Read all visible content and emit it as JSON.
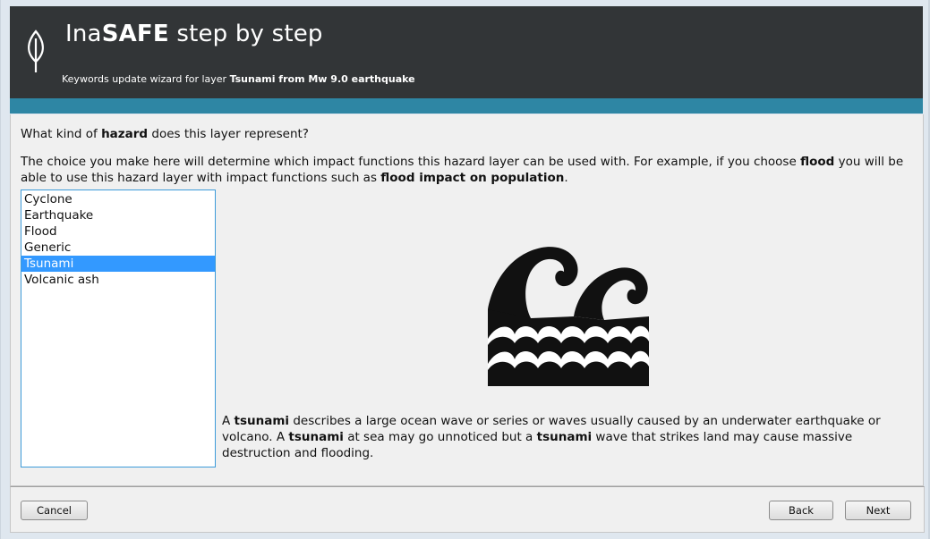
{
  "header": {
    "title_plain": "Ina",
    "title_bold": "SAFE",
    "title_rest": " step by step",
    "subtitle_prefix": "Keywords update wizard for layer ",
    "layer_name": "Tsunami from Mw 9.0 earthquake"
  },
  "question": {
    "pre": "What kind of ",
    "bold": "hazard",
    "post": " does this layer represent?"
  },
  "description": {
    "part1": "The choice you make here will determine which impact functions this hazard layer can be used with. For example, if you choose ",
    "bold1": "flood",
    "part2": " you will be able to use this hazard layer with impact functions such as ",
    "bold2": "flood impact on population",
    "part3": "."
  },
  "hazards": {
    "items": [
      "Cyclone",
      "Earthquake",
      "Flood",
      "Generic",
      "Tsunami",
      "Volcanic ash"
    ],
    "selected": "Tsunami"
  },
  "hazard_icon": "tsunami-waves-icon",
  "hazard_description": {
    "s1": "A ",
    "b1": "tsunami",
    "s2": " describes a large ocean wave or series or waves usually caused by an underwater earthquake or volcano. A ",
    "b2": "tsunami",
    "s3": " at sea may go unnoticed but a ",
    "b3": "tsunami",
    "s4": " wave that strikes land may cause massive destruction and flooding."
  },
  "buttons": {
    "cancel": "Cancel",
    "back": "Back",
    "next": "Next"
  },
  "colors": {
    "header_bg": "#323537",
    "accent_bar": "#2e86a4",
    "selection": "#3399ff"
  }
}
